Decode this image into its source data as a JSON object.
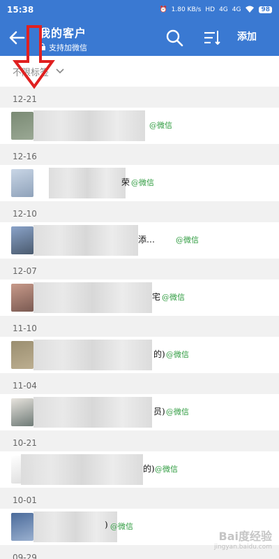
{
  "status_bar": {
    "time": "15:38",
    "net_speed": "1.80 KB/s",
    "hd": "HD",
    "signal1": "4G",
    "signal2": "4G",
    "battery": "98"
  },
  "header": {
    "title": "我的客户",
    "subtitle": "支持加微信",
    "add_label": "添加"
  },
  "filter": {
    "label": "不限标签"
  },
  "groups": [
    {
      "date": "12-21",
      "suffix": "",
      "source": "@微信"
    },
    {
      "date": "12-16",
      "suffix": "荣",
      "source": "@微信"
    },
    {
      "date": "12-10",
      "suffix": "添…",
      "source": "@微信"
    },
    {
      "date": "12-07",
      "suffix": "宅",
      "source": "@微信"
    },
    {
      "date": "11-10",
      "suffix": "的)",
      "source": "@微信"
    },
    {
      "date": "11-04",
      "suffix": "员)",
      "source": "@微信"
    },
    {
      "date": "10-21",
      "suffix": "的)",
      "source": "@微信"
    },
    {
      "date": "10-01",
      "suffix": ")",
      "source": "@微信"
    },
    {
      "date": "09-29",
      "suffix": "",
      "source": ""
    }
  ],
  "colors": {
    "header": "#3a79d2",
    "source_green": "#2e9b3f",
    "arrow_red": "#e02020"
  },
  "watermark": {
    "brand": "Bai度经验",
    "url": "jingyan.baidu.com"
  }
}
